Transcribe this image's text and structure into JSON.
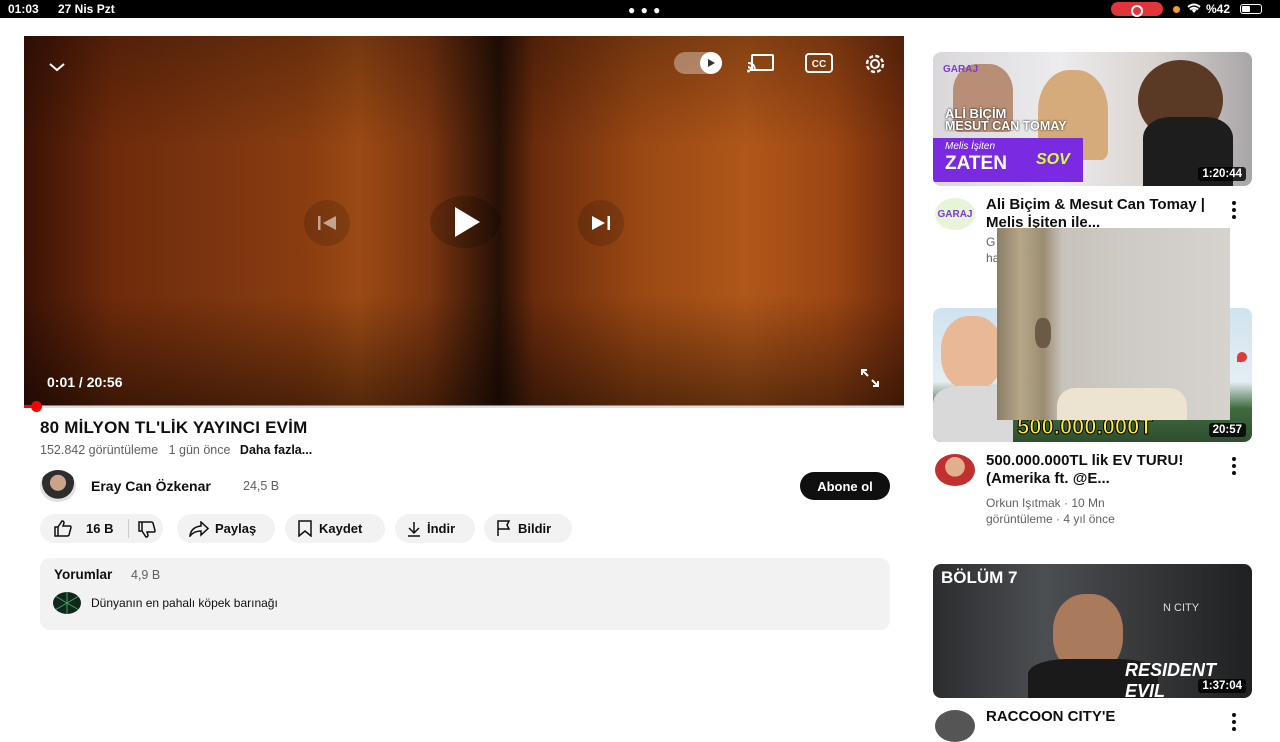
{
  "status_bar": {
    "time": "01:03",
    "date": "27 Nis Pzt",
    "battery": "%42"
  },
  "player": {
    "timecode": "0:01 / 20:56",
    "progress_fraction": 0.014,
    "accent_color": "#ff0000"
  },
  "video": {
    "title": "80 MİLYON TL'LİK YAYINCI EVİM",
    "views": "152.842 görüntüleme",
    "age": "1 gün önce",
    "more": "Daha fazla..."
  },
  "channel": {
    "name": "Eray Can Özkenar",
    "subscribers": "24,5 B",
    "subscribe_label": "Abone ol"
  },
  "actions": {
    "likes": "16 B",
    "share": "Paylaş",
    "save": "Kaydet",
    "download": "İndir",
    "report": "Bildir"
  },
  "comments": {
    "header": "Yorumlar",
    "count": "4,9 B",
    "preview": "Dünyanın en pahalı köpek barınağı"
  },
  "recommendations": [
    {
      "title": "Ali Biçim & Mesut Can Tomay | Melis İşiten ile...",
      "meta": "G",
      "meta2": "ha",
      "duration": "1:20:44",
      "thumb_texts": [
        "GARAJ",
        "ALİ BİÇİM",
        "MESUT CAN TOMAY",
        "Melis İşiten",
        "ZATEN",
        "SOV"
      ],
      "avatar_text": "GARAJ"
    },
    {
      "title": "500.000.000TL lik EV TURU! (Amerika ft. @E...",
      "meta": "Orkun Işıtmak · 10 Mn",
      "meta2": "görüntüleme · 4 yıl önce",
      "duration": "20:57",
      "thumb_texts": [
        "500.000.000T"
      ]
    },
    {
      "title": "RACCOON CITY'E",
      "duration": "1:37:04",
      "thumb_texts": [
        "BÖLÜM 7",
        "N CITY",
        "RESIDENT EVIL"
      ]
    }
  ]
}
